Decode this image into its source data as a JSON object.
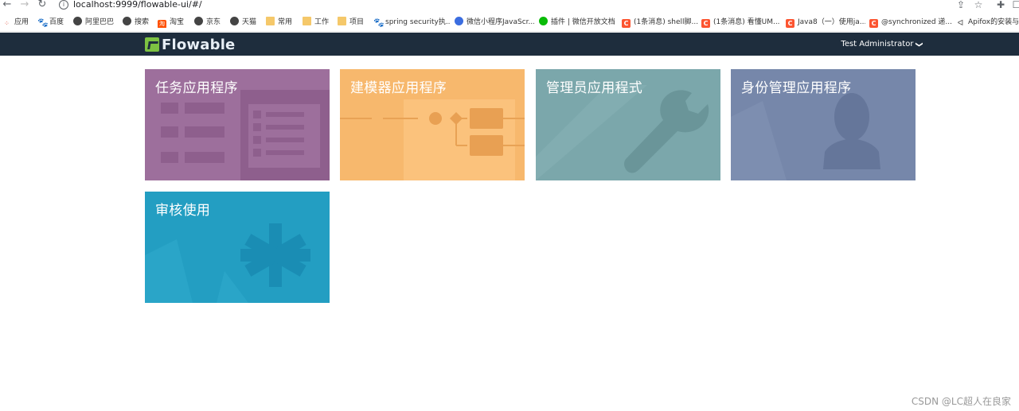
{
  "browser": {
    "url": "localhost:9999/flowable-ui/#/",
    "bookmarks": [
      {
        "label": "应用",
        "icon": "apps-grid-icon"
      },
      {
        "label": "百度",
        "icon": "baidu-paw-icon"
      },
      {
        "label": "阿里巴巴",
        "icon": "globe-icon"
      },
      {
        "label": "搜索",
        "icon": "globe-icon"
      },
      {
        "label": "淘宝",
        "icon": "taobao-icon"
      },
      {
        "label": "京东",
        "icon": "globe-icon"
      },
      {
        "label": "天猫",
        "icon": "globe-icon"
      },
      {
        "label": "常用",
        "icon": "folder-icon"
      },
      {
        "label": "工作",
        "icon": "folder-icon"
      },
      {
        "label": "项目",
        "icon": "folder-icon"
      },
      {
        "label": "spring security执...",
        "icon": "baidu-paw-icon"
      },
      {
        "label": "微信小程序JavaScr...",
        "icon": "edge-icon"
      },
      {
        "label": "插件 | 微信开放文档",
        "icon": "wechat-icon"
      },
      {
        "label": "(1条消息) shell脚...",
        "icon": "csdn-icon"
      },
      {
        "label": "(1条消息) 看懂UM...",
        "icon": "csdn-icon"
      },
      {
        "label": "Java8（一）使用ja...",
        "icon": "csdn-icon"
      },
      {
        "label": "@synchronized 递...",
        "icon": "csdn-icon"
      },
      {
        "label": "Apifox的安装与使",
        "icon": "apifox-icon"
      }
    ]
  },
  "navbar": {
    "logo_text": "Flowable",
    "user_name": "Test Administrator",
    "chevron": "❯"
  },
  "tiles": [
    {
      "title": "任务应用程序",
      "color": "#9d6f9c",
      "icon": "task-list-icon"
    },
    {
      "title": "建模器应用程序",
      "color": "#f7b86d",
      "icon": "modeler-diagram-icon"
    },
    {
      "title": "管理员应用程式",
      "color": "#7ba7ab",
      "icon": "wrench-icon"
    },
    {
      "title": "身份管理应用程序",
      "color": "#7687aa",
      "icon": "person-icon"
    },
    {
      "title": "审核使用",
      "color": "#239ec2",
      "icon": "asterisk-icon"
    }
  ],
  "watermark": "CSDN @LC超人在良家"
}
